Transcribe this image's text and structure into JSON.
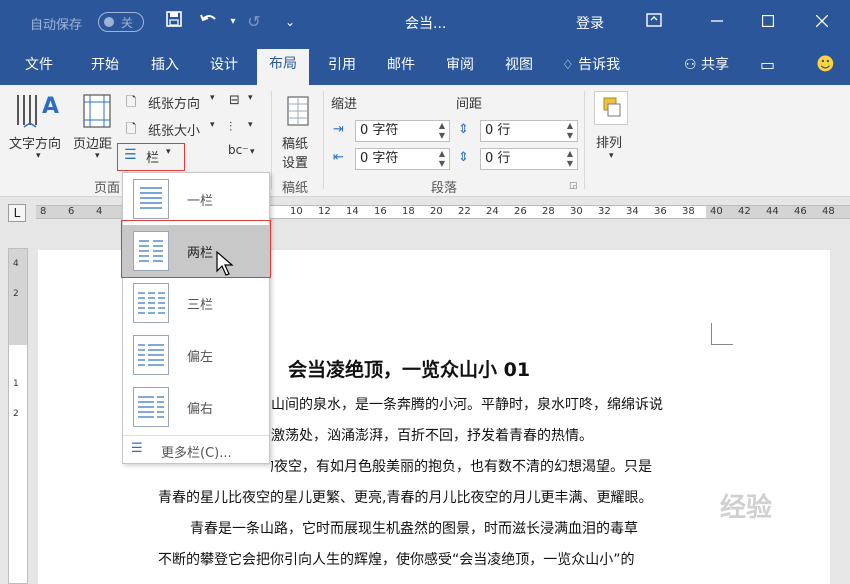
{
  "titlebar": {
    "autosave_label": "自动保存",
    "autosave_state": "关",
    "doc_title": "会当...",
    "login": "登录"
  },
  "tabs": [
    {
      "label": "文件"
    },
    {
      "label": "开始"
    },
    {
      "label": "插入"
    },
    {
      "label": "设计"
    },
    {
      "label": "布局"
    },
    {
      "label": "引用"
    },
    {
      "label": "邮件"
    },
    {
      "label": "审阅"
    },
    {
      "label": "视图"
    },
    {
      "label": "告诉我"
    },
    {
      "label": "共享"
    }
  ],
  "ribbon": {
    "text_direction": "文字方向",
    "margins": "页边距",
    "orientation": "纸张方向",
    "size": "纸张大小",
    "columns": "栏",
    "page_group": "页面",
    "draft_paper_1": "稿纸",
    "draft_paper_2": "设置",
    "draft_group": "稿纸",
    "indent_label": "缩进",
    "spacing_label": "间距",
    "indent_left": "0 字符",
    "indent_right": "0 字符",
    "spacing_before": "0 行",
    "spacing_after": "0 行",
    "paragraph_group": "段落",
    "arrange": "排列"
  },
  "ruler": {
    "ticks": [
      "8",
      "6",
      "4",
      "10",
      "12",
      "14",
      "16",
      "18",
      "20",
      "22",
      "24",
      "26",
      "28",
      "30",
      "32",
      "34",
      "36",
      "38",
      "40",
      "42",
      "44",
      "46",
      "48"
    ],
    "vticks": [
      "4",
      "2",
      "1",
      "2"
    ],
    "corner": "L"
  },
  "dropdown": {
    "items": [
      {
        "label": "一栏"
      },
      {
        "label": "两栏"
      },
      {
        "label": "三栏"
      },
      {
        "label": "偏左"
      },
      {
        "label": "偏右"
      }
    ],
    "more": "更多栏(C)..."
  },
  "document": {
    "title": "会当凌绝顶，一览众山小 01",
    "lines": [
      "山间的泉水，是一条奔腾的小河。平静时，泉水叮咚，绵绵诉说",
      "激荡处，汹涌澎湃，百折不回，抒发着青春的热情。",
      "青春是璀璨的夜空，有如月色般美丽的抱负，也有数不清的幻想渴望。只是",
      "青春的星儿比夜空的星儿更繁、更亮,青春的月儿比夜空的月儿更丰满、更耀眼。",
      "青春是一条山路，它时而展现生机盎然的图景，时而滋长浸满血泪的毒草",
      "不断的攀登它会把你引向人生的辉煌，使你感受“会当凌绝顶，一览众山小”的"
    ]
  },
  "watermark": "经验",
  "colors": {
    "brand": "#2b579a",
    "highlight_box": "#e03a3a",
    "hover": "#c8c8c8"
  }
}
